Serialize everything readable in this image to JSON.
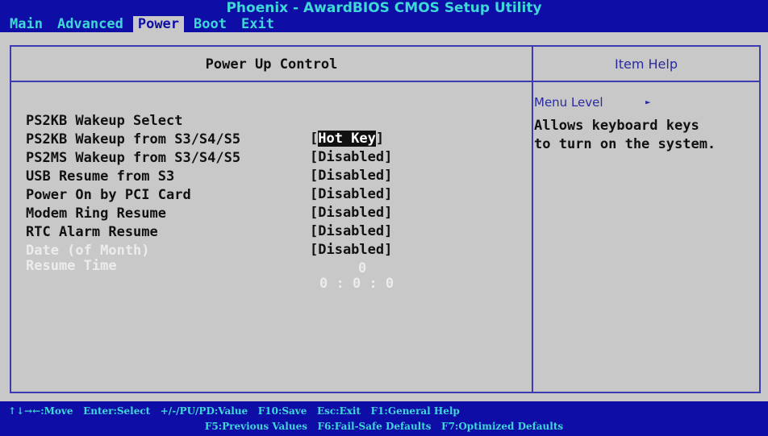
{
  "title": "Phoenix - AwardBIOS CMOS Setup Utility",
  "menu": [
    {
      "label": "Main"
    },
    {
      "label": "Advanced"
    },
    {
      "label": "Power"
    },
    {
      "label": "Boot"
    },
    {
      "label": "Exit"
    }
  ],
  "active_tab": "Power",
  "panel": {
    "title": "Power Up Control",
    "help_title": "Item Help"
  },
  "settings": [
    {
      "label": "PS2KB Wakeup Select",
      "value": "Hot Key"
    },
    {
      "label": "PS2KB Wakeup from S3/S4/S5",
      "value": "[Disabled]"
    },
    {
      "label": "PS2MS Wakeup from S3/S4/S5",
      "value": "[Disabled]"
    },
    {
      "label": "USB Resume from S3",
      "value": "[Disabled]"
    },
    {
      "label": "Power On by PCI Card",
      "value": "[Disabled]"
    },
    {
      "label": "Modem Ring Resume",
      "value": "[Disabled]"
    },
    {
      "label": "RTC Alarm Resume",
      "value": "[Disabled]"
    },
    {
      "label": "Date (of Month)",
      "value": "0"
    },
    {
      "label": "Resume Time",
      "value": "0 : 0 : 0"
    }
  ],
  "help": {
    "menu_level": "Menu Level",
    "text": "Allows keyboard keys\nto turn on the system."
  },
  "status": {
    "line1": "↑↓→←:Move   Enter:Select   +/-/PU/PD:Value   F10:Save   Esc:Exit   F1:General Help",
    "line2": "F5:Previous Values   F6:Fail-Safe Defaults   F7:Optimized Defaults"
  },
  "colors": {
    "bar_bg": "#0e0ea6",
    "bar_text": "#3fd8d8",
    "panel_bg": "#c8c8c8",
    "disabled_text": "#ececec",
    "highlight_bg": "#111111"
  }
}
